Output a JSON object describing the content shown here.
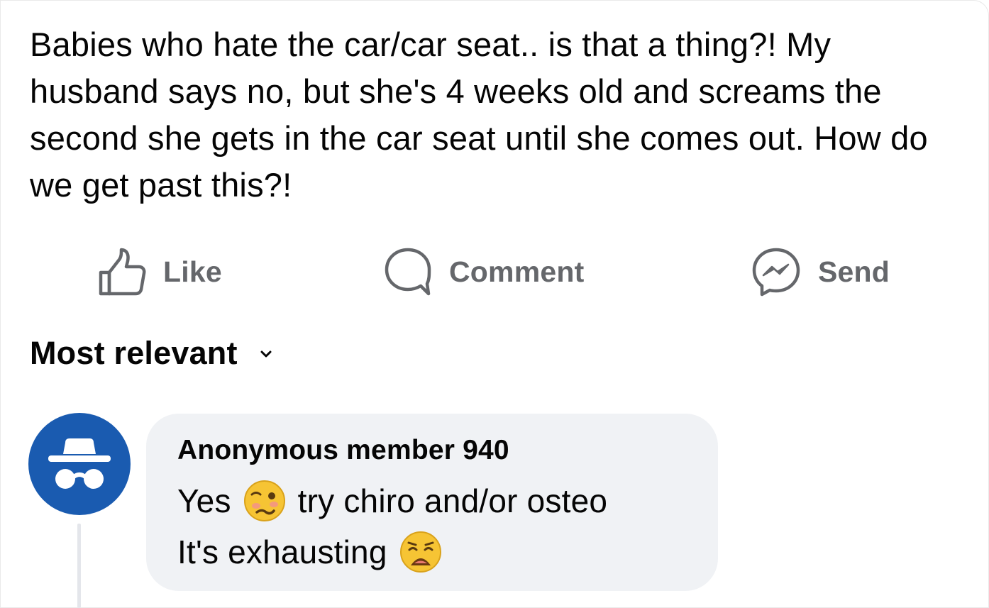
{
  "post": {
    "text": "Babies who hate the car/car seat.. is that a thing?! My husband says no, but she's 4 weeks old and screams the second she gets in the car seat until she comes out. How do we get past this?!"
  },
  "actions": {
    "like_label": "Like",
    "comment_label": "Comment",
    "send_label": "Send",
    "icons": [
      "thumbs-up-icon",
      "comment-bubble-icon",
      "messenger-icon"
    ]
  },
  "comments_sort": {
    "label": "Most relevant"
  },
  "comment": {
    "author": "Anonymous member 940",
    "line1_before": "Yes",
    "line1_after": "try chiro and/or osteo",
    "line2": "It's exhausting",
    "emoji1": "woozy-face-icon",
    "emoji2": "weary-face-icon",
    "avatar_icon": "incognito-icon"
  },
  "colors": {
    "text": "#050505",
    "secondary_text": "#65676b",
    "avatar_bg": "#1a5bb0",
    "bubble_bg": "#f0f2f5",
    "thread_line": "#e4e6eb"
  }
}
